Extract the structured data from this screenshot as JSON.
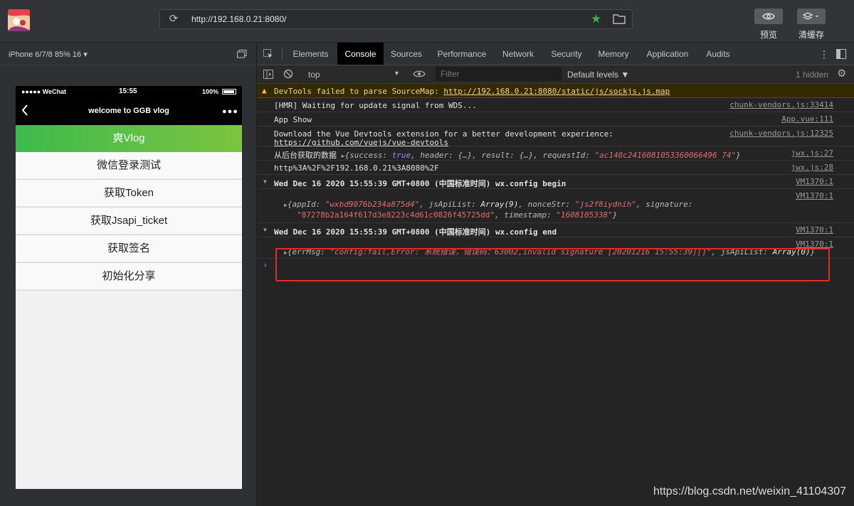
{
  "topbar": {
    "url": "http://192.168.0.21:8080/",
    "preview_label": "预览",
    "clear_cache_label": "清缓存"
  },
  "simulator": {
    "device_label": "iPhone 6/7/8 85% 16 ▾",
    "status": {
      "carrier": "●●●●● WeChat",
      "time": "15:55",
      "battery": "100%"
    },
    "nav_title": "welcome to GGB vlog",
    "header_title": "爽Vlog",
    "menu": [
      "微信登录测试",
      "获取Token",
      "获取Jsapi_ticket",
      "获取签名",
      "初始化分享"
    ]
  },
  "devtools": {
    "tabs": [
      "Elements",
      "Console",
      "Sources",
      "Performance",
      "Network",
      "Security",
      "Memory",
      "Application",
      "Audits"
    ],
    "active_tab": "Console",
    "context": "top",
    "filter_placeholder": "Filter",
    "levels": "Default levels ▼",
    "hidden": "1 hidden",
    "warning": {
      "text": "DevTools failed to parse SourceMap: ",
      "link": "http://192.168.0.21:8080/static/js/sockjs.js.map"
    },
    "logs": [
      {
        "text": "[HMR] Waiting for update signal from WDS...",
        "src": "chunk-vendors.js:33414"
      },
      {
        "text": "App Show",
        "src": "App.vue:111"
      },
      {
        "text": "Download the Vue Devtools extension for a better development experience:",
        "text2": "https://github.com/vuejs/vue-devtools",
        "src": "chunk-vendors.js:12325"
      },
      {
        "prefix": "从后台获取的数据",
        "src": "jwx.js:27"
      },
      {
        "text": "http%3A%2F%2F192.168.0.21%3A8080%2F",
        "src": "jwx.js:28"
      },
      {
        "text": "Wed Dec 16 2020 15:55:39 GMT+0800 (中国标准时间) wx.config begin",
        "src": "VM1370:1"
      },
      {
        "src": "VM1370:1"
      },
      {
        "text": "Wed Dec 16 2020 15:55:39 GMT+0800 (中国标准时间) wx.config end",
        "src": "VM1370:1"
      },
      {
        "src": "VM1370:1"
      }
    ],
    "obj1": {
      "requestId": "\"ac140c2416081053360066496 74\""
    },
    "obj2": {
      "appId": "\"wxbd9076b234a875d4\"",
      "nonceStr": "\"js2f8iydnih\"",
      "signature": "\"87278b2a164f617d3e8223c4d61c0826f45725dd\"",
      "timestamp": "\"1608105338\""
    },
    "obj3": {
      "errMsg": "\"config:fail,Error: 系统错误，错误码：63002,invalid signature [20201216 15:55:39][]\""
    }
  },
  "watermark": "https://blog.csdn.net/weixin_41104307",
  "colors": {
    "accent_green": "#3dbb4d",
    "highlight_red": "#e12b2b",
    "warning_bg": "#332a00"
  }
}
